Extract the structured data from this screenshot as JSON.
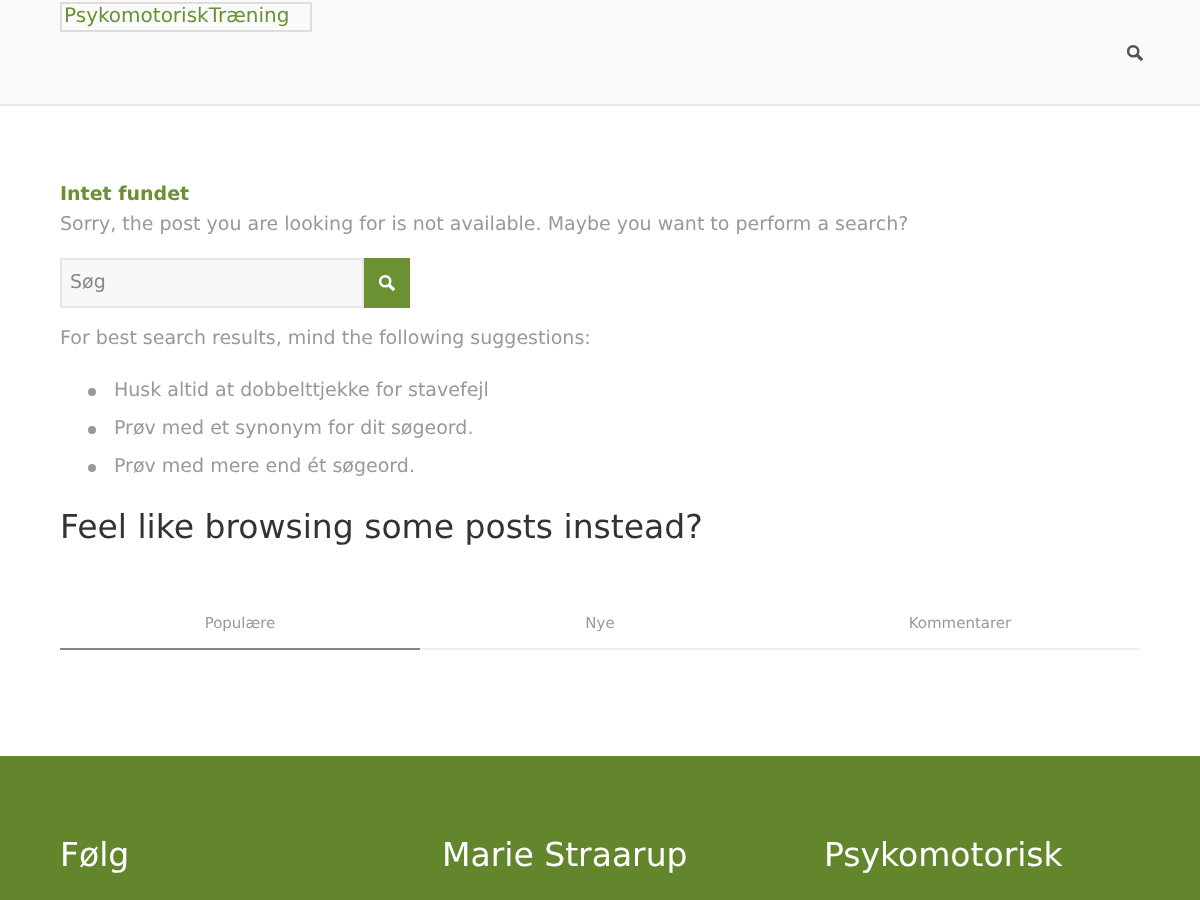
{
  "header": {
    "logo": "PsykomotoriskTræning"
  },
  "notice": {
    "title": "Intet fundet",
    "text": "Sorry, the post you are looking for is not available. Maybe you want to perform a search?"
  },
  "search": {
    "placeholder": "Søg"
  },
  "suggestions": {
    "intro": "For best search results, mind the following suggestions:",
    "items": [
      "Husk altid at dobbelttjekke for stavefejl",
      "Prøv med et synonym for dit søgeord.",
      "Prøv med mere end ét søgeord."
    ]
  },
  "browse": {
    "heading": "Feel like browsing some posts instead?"
  },
  "tabs": [
    {
      "label": "Populære",
      "selected": true
    },
    {
      "label": "Nye",
      "selected": false
    },
    {
      "label": "Kommentarer",
      "selected": false
    }
  ],
  "footer": {
    "headings": [
      "Følg",
      "Marie Straarup",
      "Psykomotorisk"
    ]
  }
}
